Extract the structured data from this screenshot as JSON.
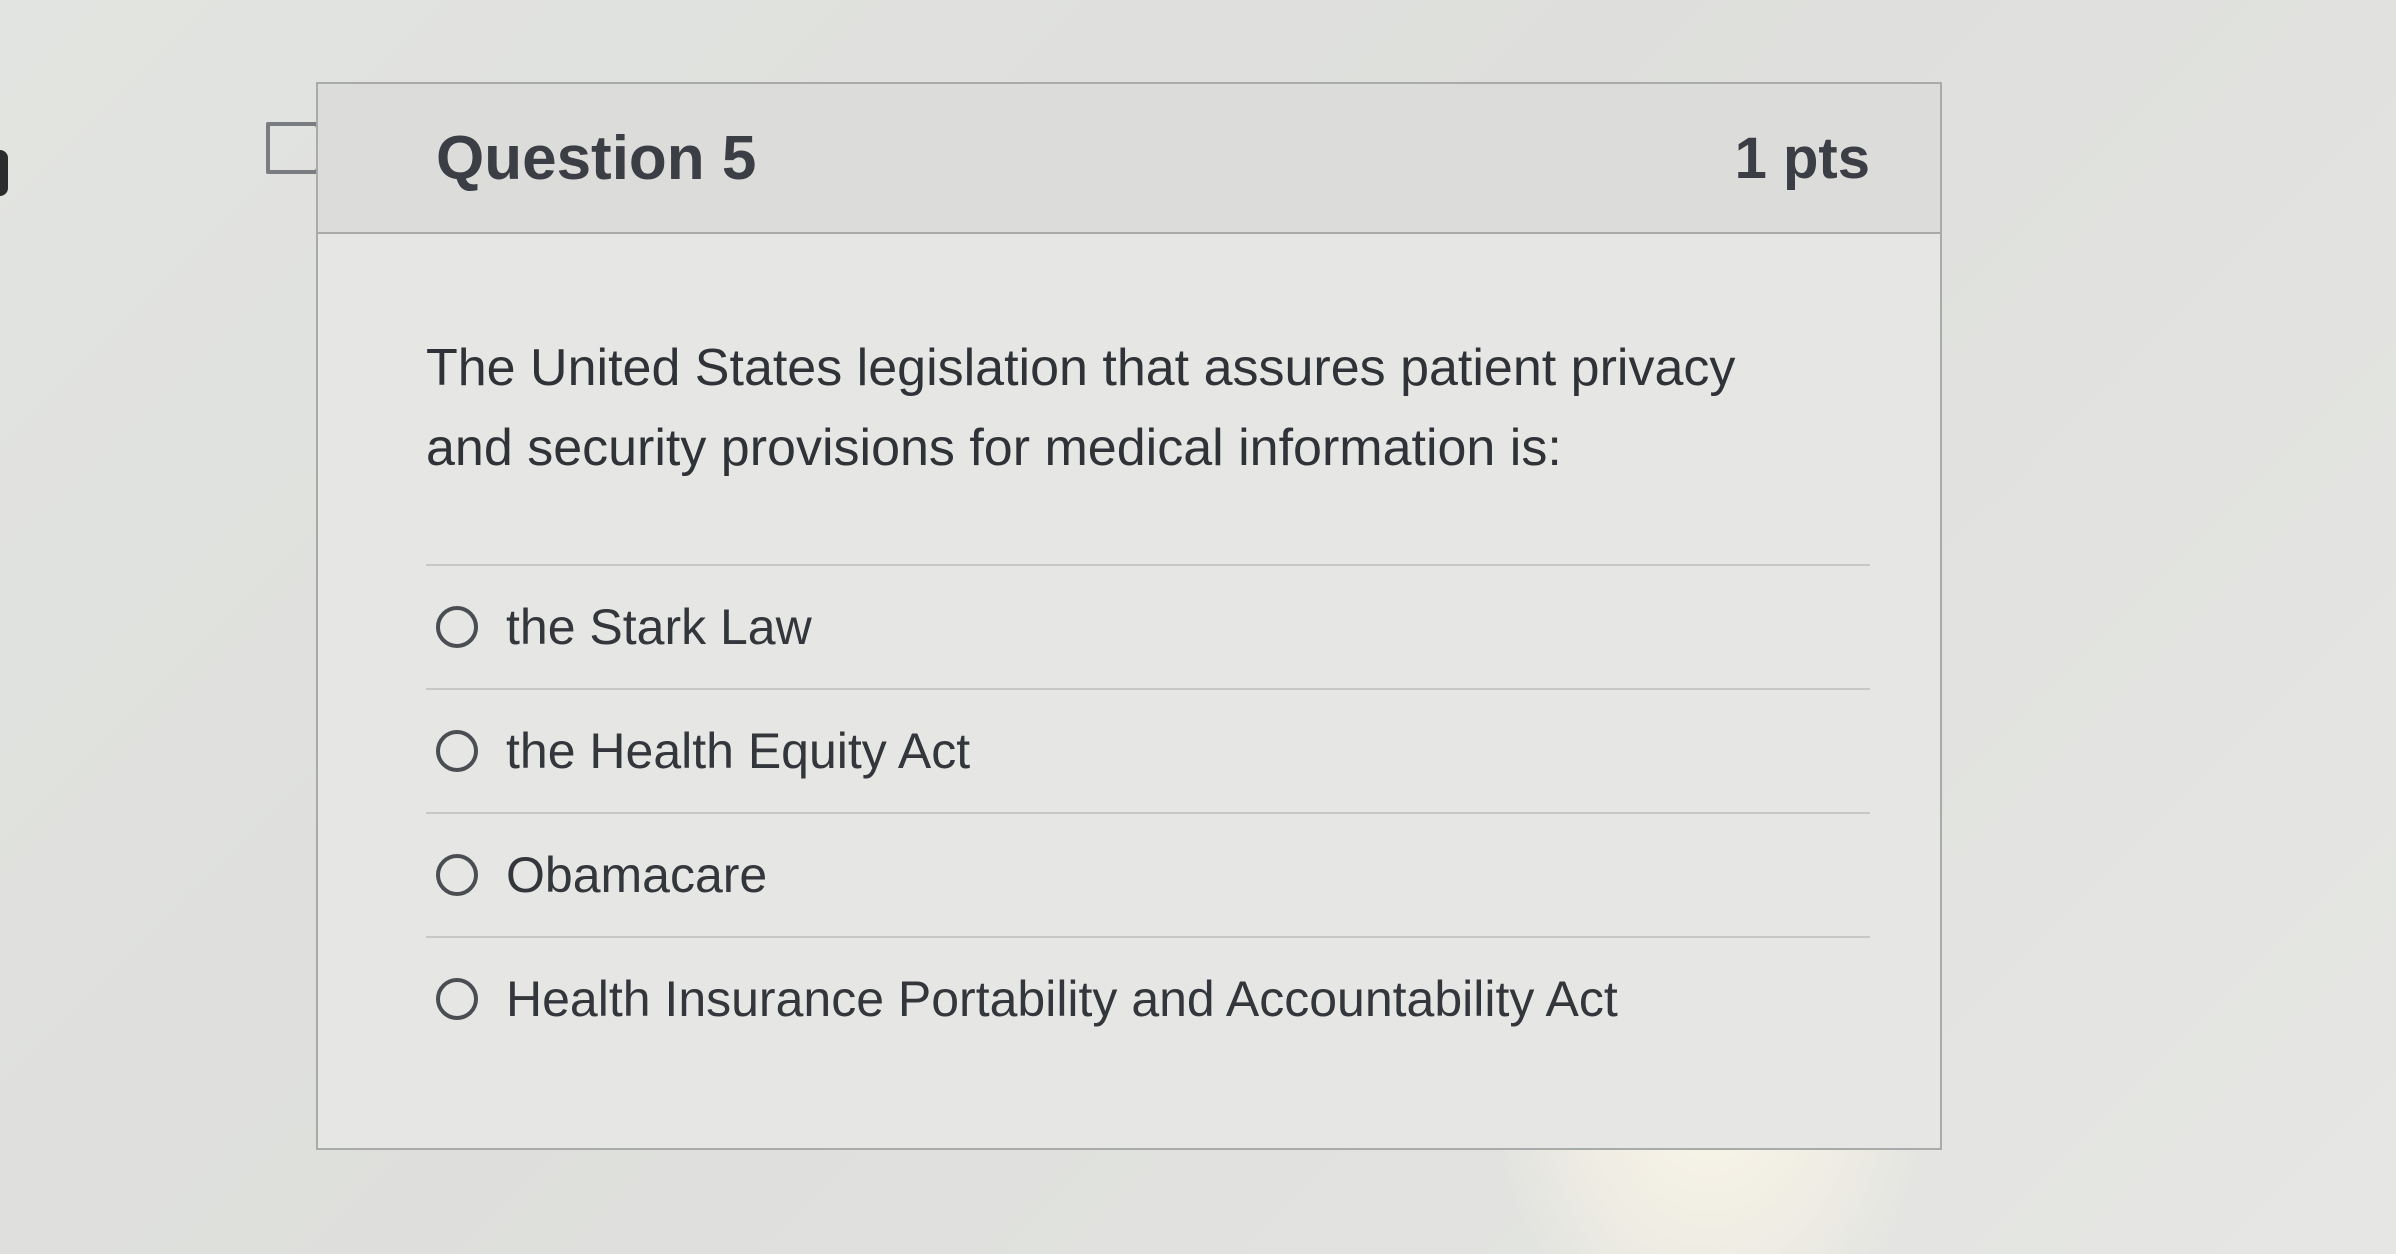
{
  "question": {
    "title": "Question 5",
    "points": "1 pts",
    "text": "The United States legislation that assures patient privacy and security provisions for medical information is:",
    "flag_icon": "flag-icon"
  },
  "answers": [
    {
      "label": "the Stark Law",
      "selected": false
    },
    {
      "label": "the Health Equity Act",
      "selected": false
    },
    {
      "label": "Obamacare",
      "selected": false
    },
    {
      "label": "Health Insurance Portability and Accountability Act",
      "selected": false
    }
  ]
}
